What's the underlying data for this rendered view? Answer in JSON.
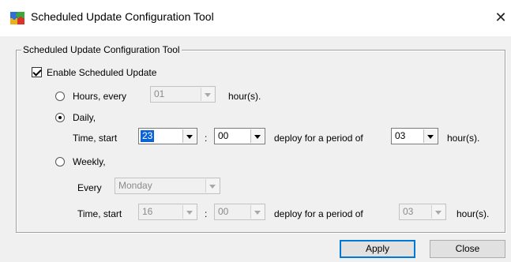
{
  "window": {
    "title": "Scheduled Update Configuration Tool",
    "icon": "puzzle-app-icon",
    "close_glyph": "✕"
  },
  "group": {
    "legend": "Scheduled Update Configuration Tool",
    "enable_label": "Enable Scheduled Update",
    "enable_checked": true
  },
  "hours_option": {
    "label": "Hours, every",
    "value": "01",
    "unit": "hour(s).",
    "selected": false,
    "enabled": false
  },
  "daily_option": {
    "label": "Daily,",
    "selected": true,
    "time_label": "Time, start",
    "start_hour": "23",
    "separator": ":",
    "start_minute": "00",
    "deploy_label": "deploy for a period of",
    "period": "03",
    "unit": "hour(s)."
  },
  "weekly_option": {
    "label": "Weekly,",
    "selected": false,
    "every_label": "Every",
    "day": "Monday",
    "time_label": "Time, start",
    "start_hour": "16",
    "separator": ":",
    "start_minute": "00",
    "deploy_label": "deploy for a period of",
    "period": "03",
    "unit": "hour(s)."
  },
  "buttons": {
    "apply": "Apply",
    "close": "Close"
  },
  "colors": {
    "selection": "#0a64d8",
    "dialog_bg": "#f0f0f0",
    "default_button_border": "#0078d7"
  }
}
